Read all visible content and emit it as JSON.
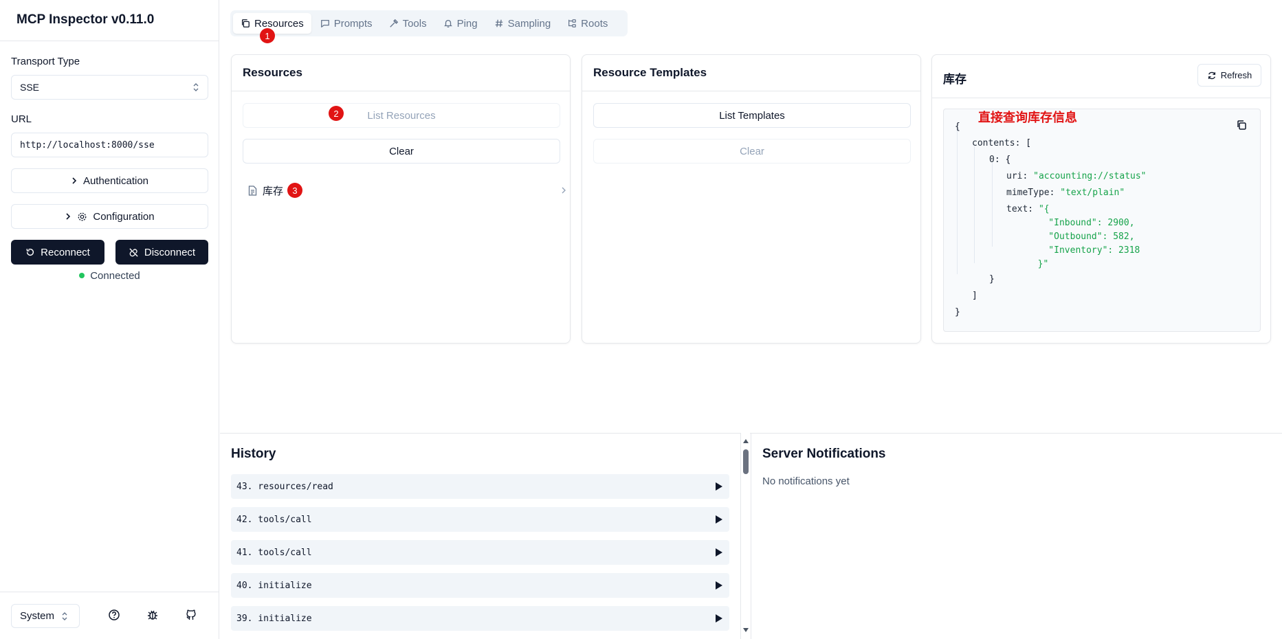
{
  "sidebar": {
    "title": "MCP Inspector v0.11.0",
    "transport_label": "Transport Type",
    "transport_value": "SSE",
    "url_label": "URL",
    "url_value": "http://localhost:8000/sse",
    "auth_label": "Authentication",
    "config_label": "Configuration",
    "reconnect_label": "Reconnect",
    "disconnect_label": "Disconnect",
    "status": "Connected",
    "theme_value": "System"
  },
  "tabs": [
    {
      "label": "Resources",
      "icon": "copy-icon"
    },
    {
      "label": "Prompts",
      "icon": "message-icon"
    },
    {
      "label": "Tools",
      "icon": "hammer-icon"
    },
    {
      "label": "Ping",
      "icon": "bell-icon"
    },
    {
      "label": "Sampling",
      "icon": "hash-icon"
    },
    {
      "label": "Roots",
      "icon": "folder-tree-icon"
    }
  ],
  "badges": [
    "1",
    "2",
    "3"
  ],
  "resources": {
    "title": "Resources",
    "list_label": "List Resources",
    "clear_label": "Clear",
    "items": [
      {
        "name": "库存"
      }
    ]
  },
  "templates": {
    "title": "Resource Templates",
    "list_label": "List Templates",
    "clear_label": "Clear"
  },
  "detail": {
    "title": "库存",
    "refresh_label": "Refresh",
    "annotation": "直接查询库存信息",
    "json": {
      "open": "{",
      "contents_key": "contents:",
      "open_bracket": "[",
      "idx_key": "0:",
      "idx_open": "{",
      "uri_key": "uri:",
      "uri_val": "\"accounting://status\"",
      "mime_key": "mimeType:",
      "mime_val": "\"text/plain\"",
      "text_key": "text:",
      "text_lines": [
        "\"{",
        "    \"Inbound\": 2900,",
        "    \"Outbound\": 582,",
        "    \"Inventory\": 2318",
        "  }\""
      ],
      "idx_close": "}",
      "close_bracket": "]",
      "close": "}"
    }
  },
  "history": {
    "title": "History",
    "items": [
      "43. resources/read",
      "42. tools/call",
      "41. tools/call",
      "40. initialize",
      "39. initialize"
    ]
  },
  "notifications": {
    "title": "Server Notifications",
    "empty": "No notifications yet"
  }
}
